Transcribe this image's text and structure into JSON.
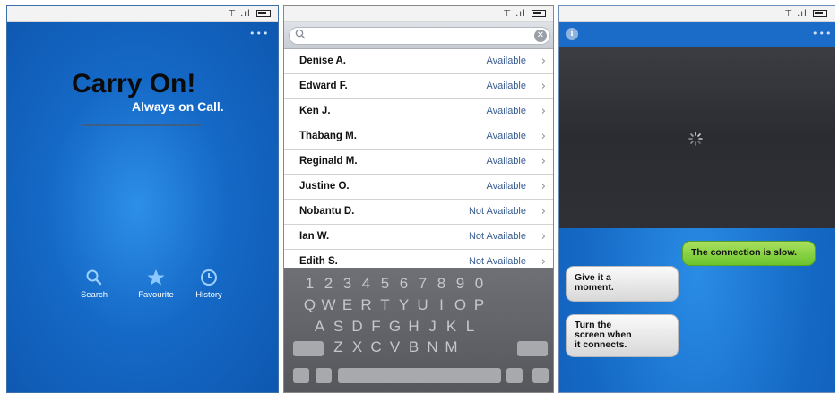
{
  "screen1": {
    "app_title": "Carry On!",
    "tagline": "Always on Call.",
    "menu_dots": "•••",
    "nav": [
      {
        "label": "Search",
        "icon": "search-icon"
      },
      {
        "label": "Favourite",
        "icon": "star-icon"
      },
      {
        "label": "History",
        "icon": "clock-icon"
      }
    ]
  },
  "screen2": {
    "search": {
      "placeholder": "",
      "value": ""
    },
    "contacts": [
      {
        "name": "Denise A.",
        "status": "Available"
      },
      {
        "name": "Edward F.",
        "status": "Available"
      },
      {
        "name": "Ken J.",
        "status": "Available"
      },
      {
        "name": "Thabang M.",
        "status": "Available"
      },
      {
        "name": "Reginald M.",
        "status": "Available"
      },
      {
        "name": "Justine O.",
        "status": "Available"
      },
      {
        "name": "Nobantu D.",
        "status": "Not Available"
      },
      {
        "name": "Ian W.",
        "status": "Not Available"
      },
      {
        "name": "Edith S.",
        "status": "Not Available"
      }
    ],
    "keyboard": {
      "row1": [
        "1",
        "2",
        "3",
        "4",
        "5",
        "6",
        "7",
        "8",
        "9",
        "0"
      ],
      "row2": [
        "Q",
        "W",
        "E",
        "R",
        "T",
        "Y",
        "U",
        "I",
        "O",
        "P"
      ],
      "row3": [
        "A",
        "S",
        "D",
        "F",
        "G",
        "H",
        "J",
        "K",
        "L"
      ],
      "row4": [
        "Z",
        "X",
        "C",
        "V",
        "B",
        "N",
        "M"
      ]
    }
  },
  "screen3": {
    "menu_dots": "•••",
    "info_label": "i",
    "messages": [
      {
        "from": "me",
        "text": "The connection is slow."
      },
      {
        "from": "them",
        "text": "Give it a moment."
      },
      {
        "from": "them",
        "text": "Turn the screen when it connects."
      }
    ]
  },
  "colors": {
    "brand_blue": "#1569c6",
    "bubble_green": "#7ccd3a",
    "available_text": "#3a5e91"
  }
}
